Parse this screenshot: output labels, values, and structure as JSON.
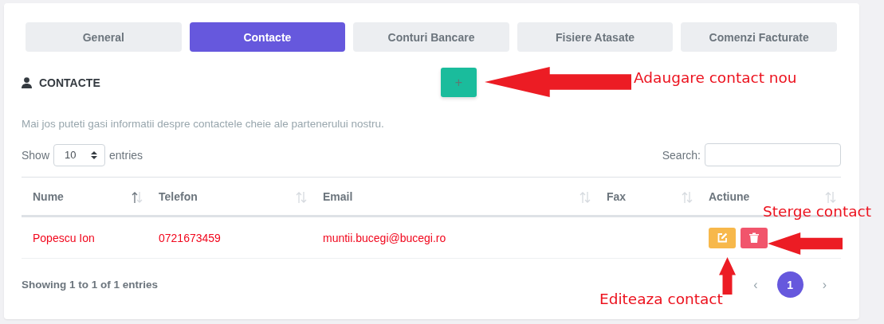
{
  "tabs": [
    {
      "label": "General",
      "selected": false
    },
    {
      "label": "Contacte",
      "selected": true
    },
    {
      "label": "Conturi Bancare",
      "selected": false
    },
    {
      "label": "Fisiere Atasate",
      "selected": false
    },
    {
      "label": "Comenzi Facturate",
      "selected": false
    }
  ],
  "section": {
    "title": "CONTACTE",
    "add_button": "+",
    "description": "Mai jos puteti gasi informatii despre contactele cheie ale partenerului nostru."
  },
  "length_menu": {
    "prefix": "Show",
    "value": "10",
    "suffix": "entries"
  },
  "search": {
    "label": "Search:"
  },
  "table": {
    "columns": [
      {
        "label": "Nume",
        "kind": "sorted"
      },
      {
        "label": "Telefon",
        "kind": "sortable"
      },
      {
        "label": "Email",
        "kind": "sortable"
      },
      {
        "label": "Fax",
        "kind": "sortable"
      },
      {
        "label": "Actiune",
        "kind": "sortable"
      }
    ],
    "rows": [
      {
        "name": "Popescu Ion",
        "phone": "0721673459",
        "email": "muntii.bucegi@bucegi.ro"
      }
    ]
  },
  "info": "Showing 1 to 1 of 1 entries",
  "pagination": {
    "prev": "‹",
    "pages": [
      {
        "label": "1",
        "selected": true
      }
    ],
    "next": "›"
  },
  "annotations": [
    {
      "text": "Adaugare contact nou",
      "kind": "left"
    },
    {
      "text": "Sterge contact",
      "kind": "left"
    },
    {
      "text": "Editeaza contact",
      "kind": "up"
    }
  ]
}
